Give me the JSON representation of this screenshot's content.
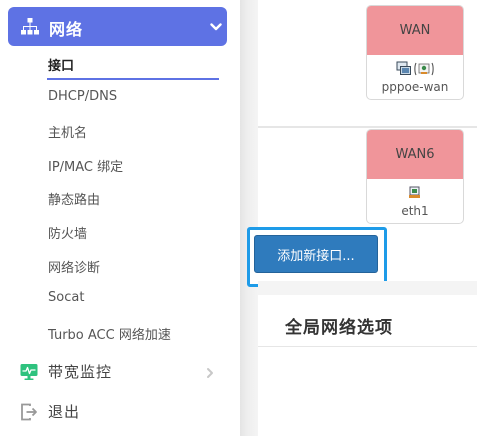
{
  "sidebar": {
    "active_group": {
      "label": "网络",
      "icon": "network-icon",
      "chevron": "chevron-down-icon"
    },
    "sub_items": [
      {
        "label": "接口",
        "active": true
      },
      {
        "label": "DHCP/DNS"
      },
      {
        "label": "主机名"
      },
      {
        "label": "IP/MAC 绑定"
      },
      {
        "label": "静态路由"
      },
      {
        "label": "防火墙"
      },
      {
        "label": "网络诊断"
      },
      {
        "label": "Socat"
      },
      {
        "label": "Turbo ACC 网络加速"
      }
    ],
    "bandwidth": {
      "label": "带宽监控",
      "icon": "monitor-icon"
    },
    "logout": {
      "label": "退出",
      "icon": "logout-icon"
    }
  },
  "main": {
    "interfaces": [
      {
        "zone": "WAN",
        "device": "pppoe-wan",
        "color": "#f0959a"
      },
      {
        "zone": "WAN6",
        "device": "eth1",
        "color": "#f0959a"
      }
    ],
    "add_button_label": "添加新接口...",
    "global_options_title": "全局网络选项"
  },
  "colors": {
    "accent": "#5e72e4",
    "button": "#2f7bbd",
    "highlight": "#1e9be8"
  }
}
